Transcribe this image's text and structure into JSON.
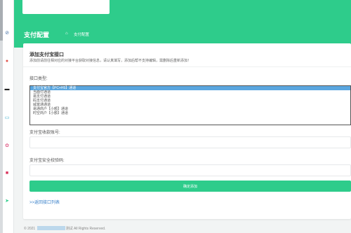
{
  "sidebar": {
    "icons": [
      {
        "name": "compass-icon",
        "glyph": "⊘",
        "color": "#4a74a8"
      },
      {
        "name": "user-icon",
        "glyph": "●",
        "color": "#e0524a"
      },
      {
        "name": "mail-icon",
        "glyph": "▬",
        "color": "#222222"
      },
      {
        "name": "card-icon",
        "glyph": "▭",
        "color": "#3fb0d0"
      },
      {
        "name": "gear-icon",
        "glyph": "✿",
        "color": "#e0608a"
      },
      {
        "name": "bag-icon",
        "glyph": "■",
        "color": "#d8305a"
      },
      {
        "name": "send-icon",
        "glyph": "➤",
        "color": "#2ecc8b"
      }
    ]
  },
  "header": {
    "title": "支付配置",
    "breadcrumb_home_icon": "⌂",
    "breadcrumb_current": "支付配置"
  },
  "card": {
    "title": "添加支付宝接口",
    "description": "添加前请前往相对应的对接平台获取对接信息，请认真填写，添加后帮不支持编辑，需删除后重新添加！"
  },
  "form": {
    "interface_type_label": "接口类型:",
    "interface_options": [
      "支付宝官方【PC+H5】通道",
      "当面付通道",
      "易支付通道",
      "码支付通道",
      "威富通通道",
      "易通商户【小额】通道",
      "时空商户【小额】通道"
    ],
    "selected_index": 0,
    "account_label": "支付宝收款账号:",
    "account_value": "",
    "key_label": "支付宝安全校验码:",
    "key_value": "",
    "submit_label": "确定添加",
    "back_link": ">>返回接口列表"
  },
  "footer": {
    "prefix": "© 2021",
    "suffix": "测试 All Rights Reserved."
  },
  "colors": {
    "brand_green": "#2ecc8b",
    "selected_blue": "#5aa6df",
    "link_blue": "#3a80c9"
  }
}
